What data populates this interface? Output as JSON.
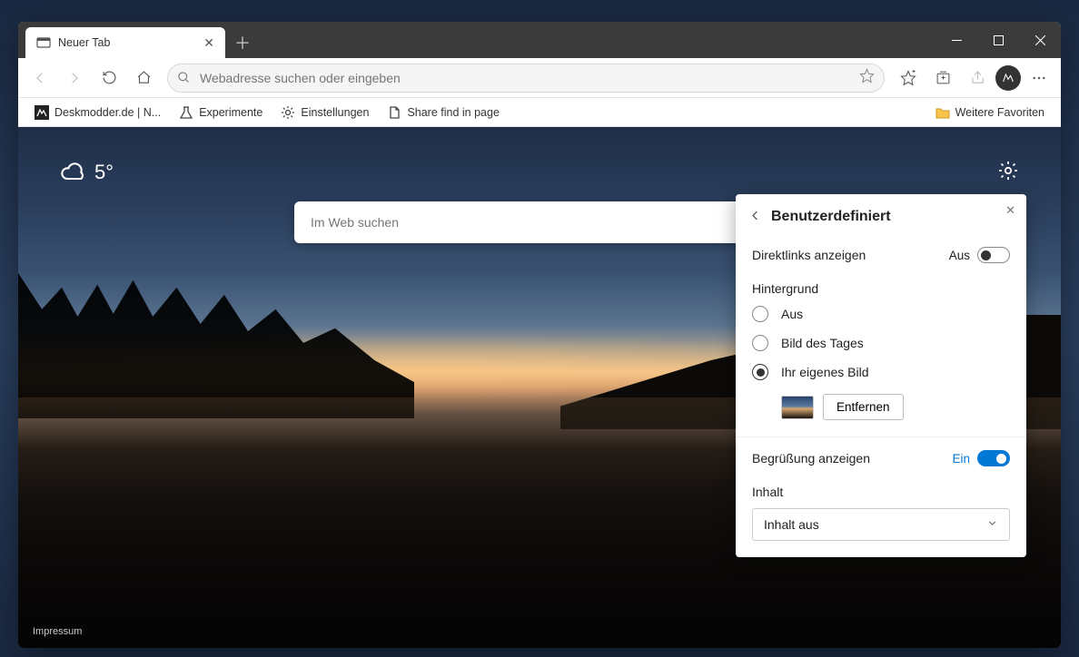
{
  "tab": {
    "title": "Neuer Tab"
  },
  "addressbar": {
    "placeholder": "Webadresse suchen oder eingeben"
  },
  "bookmarks": {
    "items": [
      {
        "label": "Deskmodder.de | N..."
      },
      {
        "label": "Experimente"
      },
      {
        "label": "Einstellungen"
      },
      {
        "label": "Share find in page"
      }
    ],
    "overflow": "Weitere Favoriten"
  },
  "weather": {
    "temp": "5°"
  },
  "websearch": {
    "placeholder": "Im Web suchen"
  },
  "footer": {
    "impressum": "Impressum"
  },
  "panel": {
    "title": "Benutzerdefiniert",
    "directlinks": {
      "label": "Direktlinks anzeigen",
      "state": "Aus"
    },
    "background": {
      "heading": "Hintergrund",
      "options": [
        "Aus",
        "Bild des Tages",
        "Ihr eigenes Bild"
      ],
      "selected": 2,
      "remove": "Entfernen"
    },
    "greeting": {
      "label": "Begrüßung anzeigen",
      "state": "Ein"
    },
    "content": {
      "heading": "Inhalt",
      "selected": "Inhalt aus"
    }
  }
}
